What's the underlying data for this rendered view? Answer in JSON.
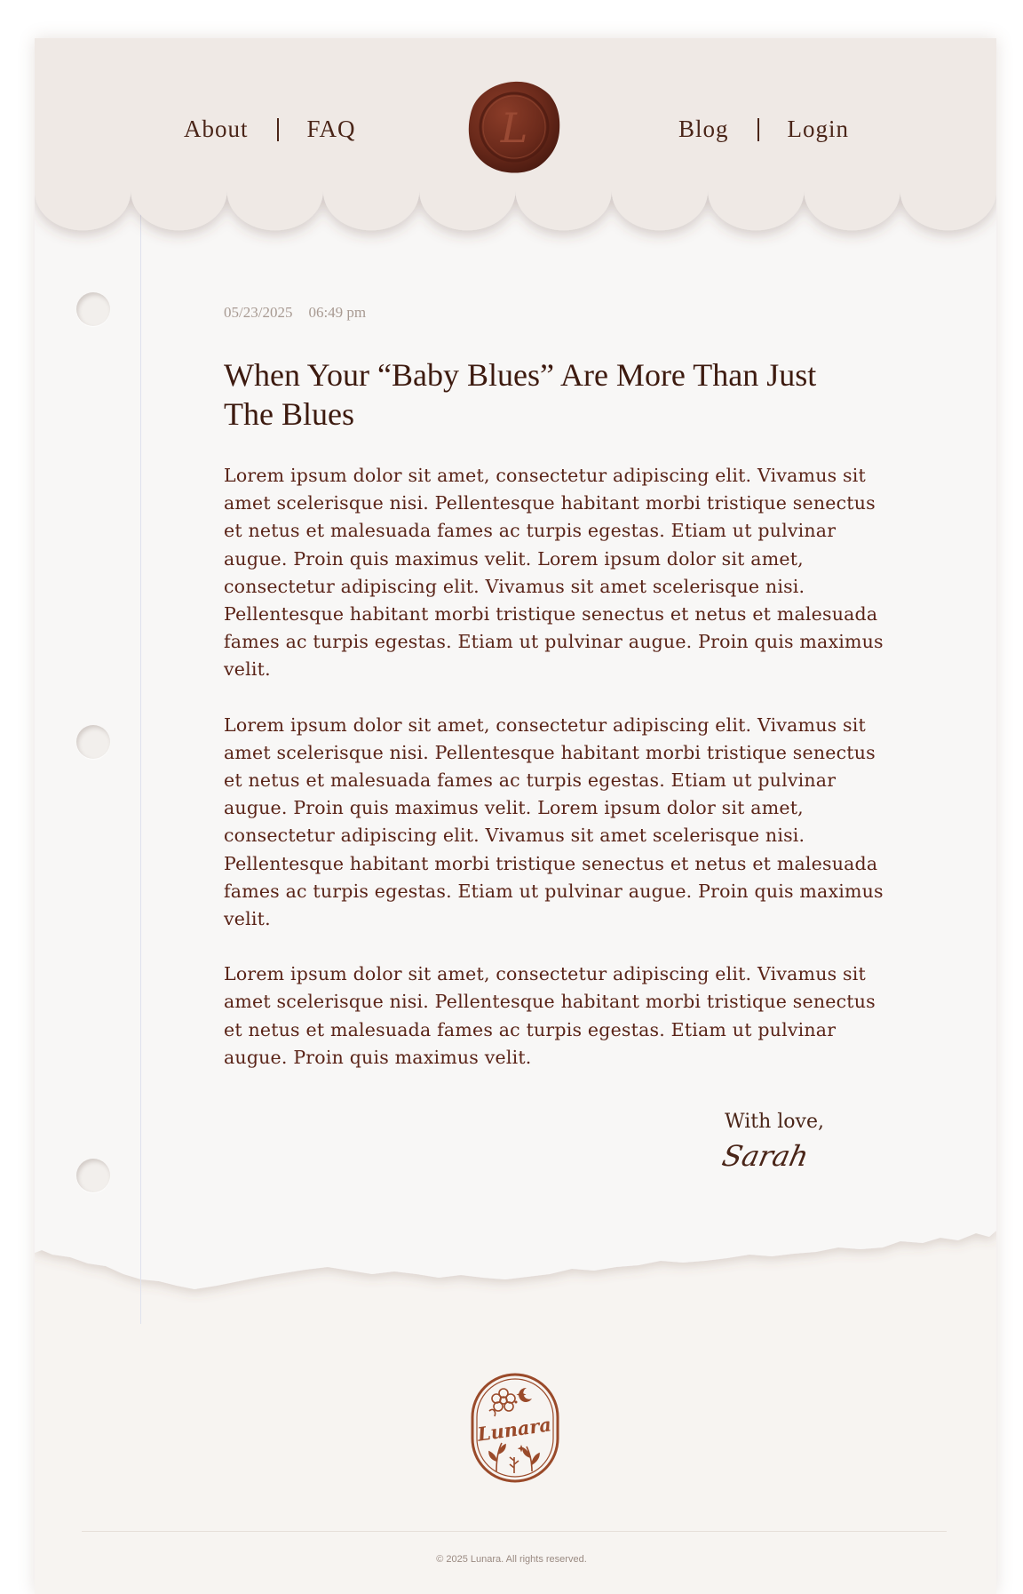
{
  "nav": {
    "left": [
      "About",
      "FAQ"
    ],
    "right": [
      "Blog",
      "Login"
    ]
  },
  "seal": {
    "letter": "L",
    "color": "#6b2c1c"
  },
  "post": {
    "date": "05/23/2025",
    "time": "06:49 pm",
    "title": "When Your “Baby Blues” Are More Than Just The Blues",
    "paragraphs": [
      "Lorem ipsum dolor sit amet, consectetur adipiscing elit. Vivamus sit amet scelerisque nisi. Pellentesque habitant morbi tristique senectus et netus et malesuada fames ac turpis egestas. Etiam ut pulvinar augue. Proin quis maximus velit. Lorem ipsum dolor sit amet, consectetur adipiscing elit. Vivamus sit amet scelerisque nisi. Pellentesque habitant morbi tristique senectus et netus et malesuada fames ac turpis egestas. Etiam ut pulvinar augue. Proin quis maximus velit.",
      "Lorem ipsum dolor sit amet, consectetur adipiscing elit. Vivamus sit amet scelerisque nisi. Pellentesque habitant morbi tristique senectus et netus et malesuada fames ac turpis egestas. Etiam ut pulvinar augue. Proin quis maximus velit. Lorem ipsum dolor sit amet, consectetur adipiscing elit. Vivamus sit amet scelerisque nisi. Pellentesque habitant morbi tristique senectus et netus et malesuada fames ac turpis egestas. Etiam ut pulvinar augue. Proin quis maximus velit.",
      "Lorem ipsum dolor sit amet, consectetur adipiscing elit. Vivamus sit amet scelerisque nisi. Pellentesque habitant morbi tristique senectus et netus et malesuada fames ac turpis egestas. Etiam ut pulvinar augue. Proin quis maximus velit."
    ],
    "signoff": "With love,",
    "signature": "Sarah"
  },
  "logo": {
    "text": "Lunara",
    "color": "#9a4a2a"
  },
  "footer": {
    "copyright": "© 2025 Lunara. All rights reserved."
  },
  "colors": {
    "text": "#4a2518",
    "paper": "#f7f4f1",
    "header": "#eee8e4"
  }
}
